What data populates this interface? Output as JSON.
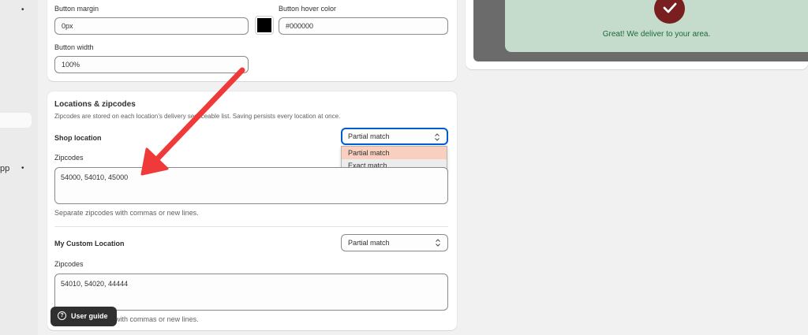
{
  "nav": {
    "app_label": "pp"
  },
  "button_settings": {
    "margin_label": "Button margin",
    "margin_value": "0px",
    "hover_color_label": "Button hover color",
    "hover_color_value": "#000000",
    "width_label": "Button width",
    "width_value": "100%",
    "swatch_color": "#000000"
  },
  "locations": {
    "heading": "Locations & zipcodes",
    "description": "Zipcodes are stored on each location’s delivery serviceable list. Saving persists every location at once.",
    "items": [
      {
        "name": "Shop location",
        "match_value": "Partial match",
        "zipcodes_label": "Zipcodes",
        "zipcodes_value": "54000, 54010, 45000",
        "help": "Separate zipcodes with commas or new lines."
      },
      {
        "name": "My Custom Location",
        "match_value": "Partial match",
        "zipcodes_label": "Zipcodes",
        "zipcodes_value": "54010, 54020, 44444",
        "help": "Separate zipcodes with commas or new lines."
      }
    ],
    "dropdown_options": [
      "Partial match",
      "Exact match"
    ]
  },
  "preview": {
    "message": "Great! We deliver to your area.",
    "check_color": "#7a1f1f",
    "panel_color": "#c5dbcc"
  },
  "user_guide": {
    "label": "User guide",
    "icon": "question-circle-icon"
  },
  "annotation": {
    "arrow_color": "#f03a3a"
  }
}
